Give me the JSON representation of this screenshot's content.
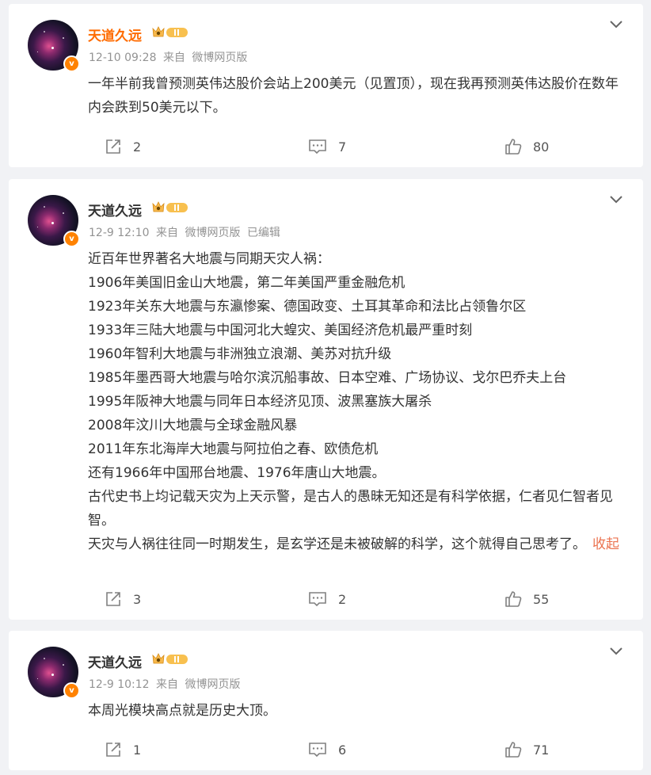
{
  "posts": [
    {
      "author": "天道久远",
      "time": "12-10 09:28",
      "source_prefix": "来自",
      "source": "微博网页版",
      "edited": "",
      "content": [
        "一年半前我曾预测英伟达股价会站上200美元（见置顶），现在我再预测英伟达股价在数年内会跌到50美元以下。"
      ],
      "collapse_label": "",
      "reposts": "2",
      "comments": "7",
      "likes": "80"
    },
    {
      "author": "天道久远",
      "time": "12-9 12:10",
      "source_prefix": "来自",
      "source": "微博网页版",
      "edited": "已编辑",
      "content": [
        "近百年世界著名大地震与同期天灾人祸：",
        "1906年美国旧金山大地震，第二年美国严重金融危机",
        "1923年关东大地震与东瀛惨案、德国政变、土耳其革命和法比占领鲁尔区",
        "1933年三陆大地震与中国河北大蝗灾、美国经济危机最严重时刻",
        "1960年智利大地震与非洲独立浪潮、美苏对抗升级",
        "1985年墨西哥大地震与哈尔滨沉船事故、日本空难、广场协议、戈尔巴乔夫上台",
        "1995年阪神大地震与同年日本经济见顶、波黑塞族大屠杀",
        "2008年汶川大地震与全球金融风暴",
        "2011年东北海岸大地震与阿拉伯之春、欧债危机",
        "还有1966年中国邢台地震、1976年唐山大地震。",
        "古代史书上均记载天灾为上天示警，是古人的愚昧无知还是有科学依据，仁者见仁智者见智。",
        "天灾与人祸往往同一时期发生，是玄学还是未被破解的科学，这个就得自己思考了。"
      ],
      "collapse_label": "收起",
      "reposts": "3",
      "comments": "2",
      "likes": "55"
    },
    {
      "author": "天道久远",
      "time": "12-9 10:12",
      "source_prefix": "来自",
      "source": "微博网页版",
      "edited": "",
      "content": [
        "本周光模块高点就是历史大顶。"
      ],
      "collapse_label": "",
      "reposts": "1",
      "comments": "6",
      "likes": "71"
    }
  ],
  "icons": {
    "verified_badge": "verified-v-icon",
    "level_badge": "crown-level-icon",
    "menu": "chevron-down-icon",
    "repost": "repost-icon",
    "comment": "comment-icon",
    "like": "thumbs-up-icon"
  },
  "colors": {
    "page_bg": "#f1f2f5",
    "card_bg": "#ffffff",
    "verified_orange": "#ff8200",
    "highlight_name": "#ff6b00",
    "link_orange": "#eb7350",
    "meta_gray": "#939393"
  }
}
